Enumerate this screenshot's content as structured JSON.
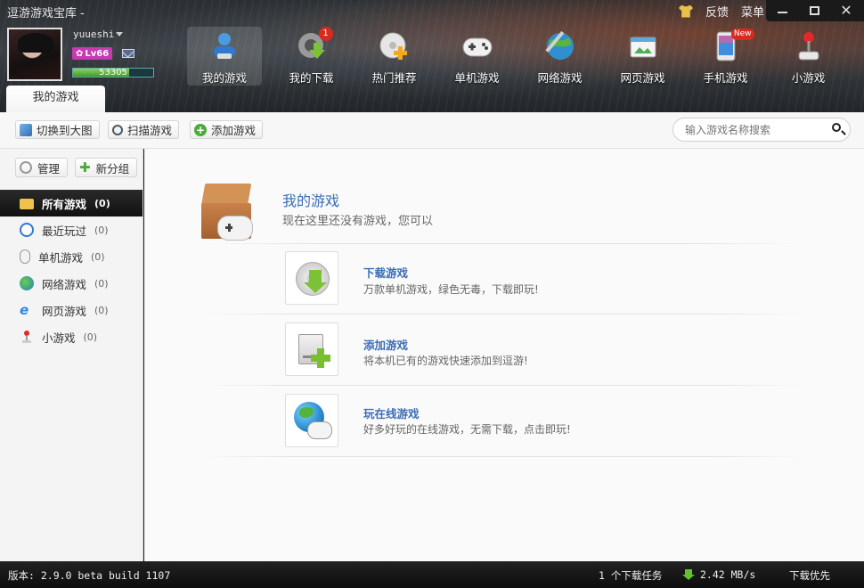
{
  "window": {
    "title": "逗游游戏宝库 -",
    "top_links": [
      "反馈",
      "菜单"
    ],
    "controls": {
      "minimize": "—",
      "maximize": "□",
      "close": "✕"
    }
  },
  "user": {
    "name": "yuueshi",
    "level": "Lv66",
    "exp": "53305",
    "exp_fill": 0.7
  },
  "nav": {
    "items": [
      {
        "label": "我的游戏",
        "icon": "my-games-icon"
      },
      {
        "label": "我的下载",
        "icon": "download-icon",
        "badge": "1"
      },
      {
        "label": "热门推荐",
        "icon": "hot-recommend-icon"
      },
      {
        "label": "单机游戏",
        "icon": "gamepad-icon"
      },
      {
        "label": "网络游戏",
        "icon": "online-game-icon"
      },
      {
        "label": "网页游戏",
        "icon": "web-game-icon"
      },
      {
        "label": "手机游戏",
        "icon": "phone-icon",
        "badge": "New"
      },
      {
        "label": "小游戏",
        "icon": "joystick-icon"
      }
    ],
    "active_tab": "我的游戏"
  },
  "toolbar": {
    "switch_label": "切换到大图",
    "scan_label": "扫描游戏",
    "add_label": "添加游戏"
  },
  "search": {
    "placeholder": "输入游戏名称搜索"
  },
  "sidebar": {
    "manage_label": "管理",
    "new_group_label": "新分组",
    "items": [
      {
        "label": "所有游戏",
        "count": "(0)"
      },
      {
        "label": "最近玩过",
        "count": "(0)"
      },
      {
        "label": "单机游戏",
        "count": "(0)"
      },
      {
        "label": "网络游戏",
        "count": "(0)"
      },
      {
        "label": "网页游戏",
        "count": "(0)"
      },
      {
        "label": "小游戏",
        "count": "(0)"
      }
    ]
  },
  "main": {
    "title": "我的游戏",
    "subtitle": "现在这里还没有游戏，您可以",
    "actions": [
      {
        "title": "下载游戏",
        "desc": "万款单机游戏，绿色无毒，下载即玩!"
      },
      {
        "title": "添加游戏",
        "desc": "将本机已有的游戏快速添加到逗游!"
      },
      {
        "title": "玩在线游戏",
        "desc": "好多好玩的在线游戏，无需下载，点击即玩!"
      }
    ]
  },
  "status": {
    "version": "版本: 2.9.0 beta build 1107",
    "tasks": "1 个下载任务",
    "speed": "2.42 MB/s",
    "mode": "下载优先"
  },
  "colors": {
    "accent": "#3a6db5",
    "green": "#7bc236",
    "badge_red": "#d82a1f"
  }
}
